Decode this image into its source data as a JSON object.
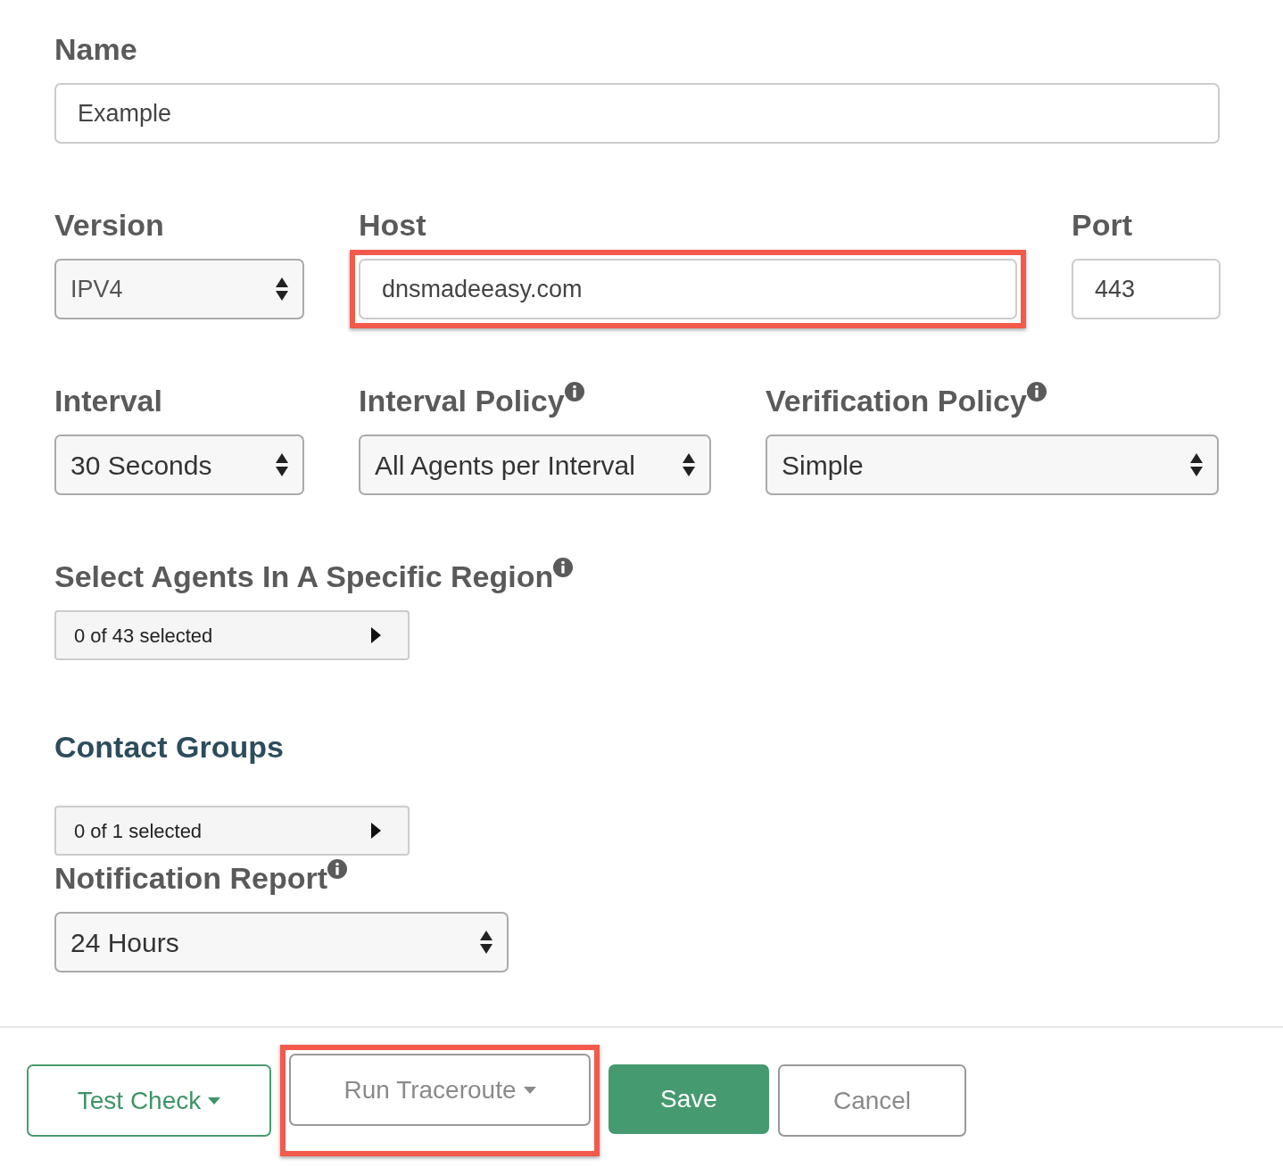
{
  "rows": [
    {
      "fields": [
        {
          "kind": "text",
          "label": "Name",
          "info": false,
          "value": "Example",
          "highlighted": false
        }
      ]
    },
    {
      "fields": [
        {
          "kind": "select",
          "label": "Version",
          "info": false,
          "value": "IPV4",
          "highlighted": false
        },
        {
          "kind": "text",
          "label": "Host",
          "info": false,
          "value": "dnsmadeeasy.com",
          "highlighted": true
        },
        {
          "kind": "text",
          "label": "Port",
          "info": false,
          "value": "443",
          "highlighted": false
        }
      ]
    },
    {
      "fields": [
        {
          "kind": "select",
          "label": "Interval",
          "info": false,
          "value": "30 Seconds",
          "highlighted": false
        },
        {
          "kind": "select",
          "label": "Interval Policy",
          "info": true,
          "value": "All Agents per Interval",
          "highlighted": false
        },
        {
          "kind": "select",
          "label": "Verification Policy",
          "info": true,
          "value": "Simple",
          "highlighted": false
        }
      ]
    },
    {
      "fields": [
        {
          "kind": "multiselect",
          "label": "Select Agents In A Specific Region",
          "info": true,
          "value": "0 of 43 selected",
          "highlighted": false
        }
      ]
    }
  ],
  "contact_groups": {
    "heading": "Contact Groups",
    "value": "0 of 1 selected"
  },
  "notification_report": {
    "label": "Notification Report",
    "info": true,
    "value": "24 Hours"
  },
  "buttons": [
    {
      "kind": "outline-success",
      "label": "Test Check",
      "dropdown": true,
      "highlighted": false
    },
    {
      "kind": "outline-secondary",
      "label": "Run Traceroute",
      "dropdown": true,
      "highlighted": true
    },
    {
      "kind": "success",
      "label": "Save",
      "dropdown": false,
      "highlighted": false
    },
    {
      "kind": "outline-secondary",
      "label": "Cancel",
      "dropdown": false,
      "highlighted": false
    }
  ]
}
